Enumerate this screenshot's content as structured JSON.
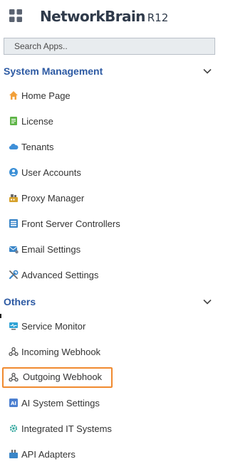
{
  "header": {
    "brand": "NetworkBrain",
    "version": "R12"
  },
  "search": {
    "placeholder": "Search Apps.."
  },
  "sections": {
    "system_management": {
      "title": "System Management",
      "items": [
        {
          "label": "Home Page",
          "icon": "home-icon"
        },
        {
          "label": "License",
          "icon": "license-icon"
        },
        {
          "label": "Tenants",
          "icon": "cloud-icon"
        },
        {
          "label": "User Accounts",
          "icon": "user-icon"
        },
        {
          "label": "Proxy Manager",
          "icon": "proxy-icon"
        },
        {
          "label": "Front Server Controllers",
          "icon": "server-controller-icon"
        },
        {
          "label": "Email Settings",
          "icon": "email-icon"
        },
        {
          "label": "Advanced Settings",
          "icon": "tools-icon"
        }
      ]
    },
    "others": {
      "title": "Others",
      "items": [
        {
          "label": "Service Monitor",
          "icon": "monitor-icon"
        },
        {
          "label": "Incoming Webhook",
          "icon": "webhook-icon"
        },
        {
          "label": "Outgoing Webhook",
          "icon": "webhook-icon",
          "highlighted": true
        },
        {
          "label": "AI System Settings",
          "icon": "ai-settings-icon"
        },
        {
          "label": "Integrated IT Systems",
          "icon": "integration-icon"
        },
        {
          "label": "API Adapters",
          "icon": "api-adapter-icon"
        }
      ]
    }
  },
  "colors": {
    "section_title": "#2d5aa3",
    "highlight_border": "#f08a2f"
  }
}
